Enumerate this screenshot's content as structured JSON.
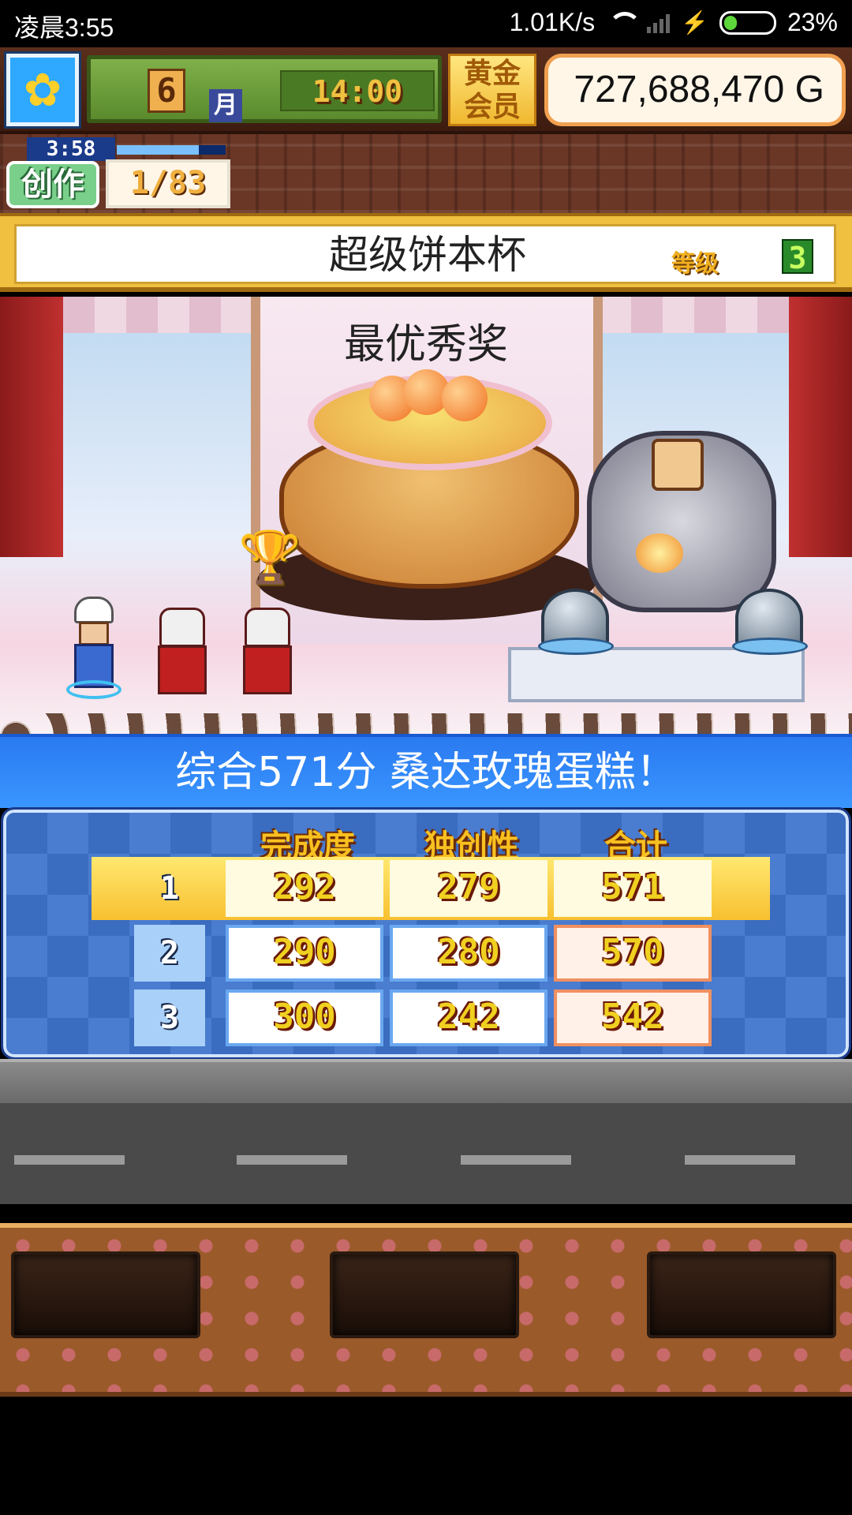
{
  "status_bar": {
    "time": "凌晨3:55",
    "network_speed": "1.01K/s",
    "battery": "23%",
    "icons": [
      "wifi-icon",
      "signal-icon",
      "charging-icon",
      "battery-icon"
    ]
  },
  "hud": {
    "season_icon": "sunflower-icon",
    "month": "6",
    "month_label": "月",
    "clock": "14:00",
    "vip_label": "黄金会员",
    "money": "727,688,470 G"
  },
  "create": {
    "timer": "3:58",
    "progress_fraction": 0.75,
    "label": "创作",
    "count": "1/83"
  },
  "contest": {
    "title": "超级饼本杯",
    "grade_label": "等级",
    "grade_value": "3"
  },
  "stage": {
    "award_title": "最优秀奖",
    "trophy_icon": "trophy-icon"
  },
  "result": {
    "text": "综合571分 桑达玫瑰蛋糕！"
  },
  "score_table": {
    "headers": [
      "完成度",
      "独创性",
      "合计"
    ],
    "rows": [
      {
        "rank": "1",
        "completion": "292",
        "originality": "279",
        "total": "571"
      },
      {
        "rank": "2",
        "completion": "290",
        "originality": "280",
        "total": "570"
      },
      {
        "rank": "3",
        "completion": "300",
        "originality": "242",
        "total": "542"
      }
    ]
  },
  "colors": {
    "result_banner": "#3a96ff",
    "highlight_row": "#f8c030",
    "header_gold": "#f8c020"
  }
}
